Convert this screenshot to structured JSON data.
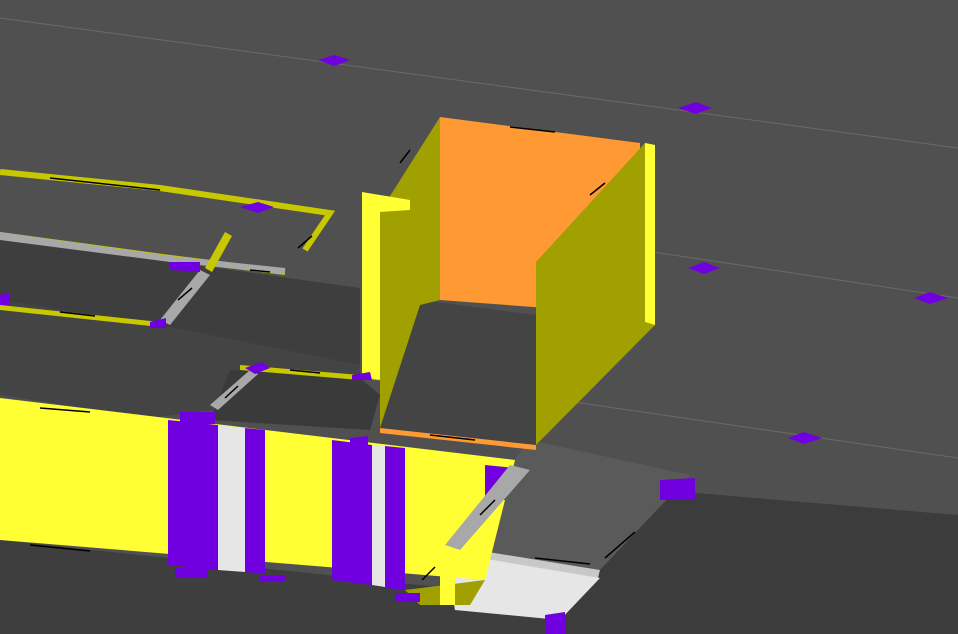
{
  "scene": {
    "background_color": "#505050",
    "floor_dark_color": "#404040",
    "floor_light_color": "#585858",
    "wall_yellow_color": "#ffff33",
    "wall_olive_color": "#a0a000",
    "wall_orange_color": "#ff9933",
    "opening_purple_color": "#7000e0",
    "panel_white_color": "#e6e6e6",
    "edge_grey_color": "#a8a8a8",
    "arrow_color": "#000000"
  }
}
